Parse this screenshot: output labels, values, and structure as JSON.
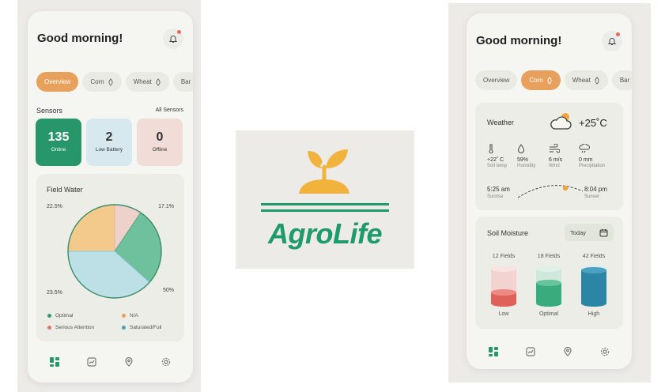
{
  "left_phone": {
    "greeting": "Good morning!",
    "tabs": [
      {
        "label": "Overview",
        "active": true
      },
      {
        "label": "Corn",
        "active": false
      },
      {
        "label": "Wheat",
        "active": false
      },
      {
        "label": "Bar",
        "active": false
      }
    ],
    "sensors": {
      "title": "Sensors",
      "link": "All Sensors",
      "boxes": [
        {
          "value": "135",
          "label": "Online"
        },
        {
          "value": "2",
          "label": "Low Battery"
        },
        {
          "value": "0",
          "label": "Offline"
        }
      ]
    },
    "field_water": {
      "title": "Field Water",
      "pct_top_left": "22.5%",
      "pct_top_right": "17.1%",
      "pct_bottom_left": "23.5%",
      "pct_right": "50%",
      "legend": [
        {
          "label": "Optimal",
          "color": "#3a9a6e"
        },
        {
          "label": "N/A",
          "color": "#e8a15c"
        },
        {
          "label": "Serious Attention",
          "color": "#d9796c"
        },
        {
          "label": "Saturated/Full",
          "color": "#4ba1b3"
        }
      ]
    }
  },
  "logo": {
    "brand": "AgroLife",
    "sprout_color": "#f2b33d",
    "brand_color": "#1e9a6b"
  },
  "right_phone": {
    "greeting": "Good morning!",
    "tabs": [
      {
        "label": "Overview",
        "active": false
      },
      {
        "label": "Corn",
        "active": true
      },
      {
        "label": "Wheat",
        "active": false
      },
      {
        "label": "Bar",
        "active": false
      }
    ],
    "weather": {
      "title": "Weather",
      "temp": "+25˚C",
      "stats": [
        {
          "value": "+22˚ C",
          "label": "Soil temp",
          "icon": "thermometer-icon"
        },
        {
          "value": "59%",
          "label": "Humidity",
          "icon": "droplet-icon"
        },
        {
          "value": "6 m/s",
          "label": "Wind",
          "icon": "wind-icon"
        },
        {
          "value": "0 mm",
          "label": "Precipitation",
          "icon": "rain-cloud-icon"
        }
      ],
      "sunrise_time": "5:25 am",
      "sunrise_label": "Sunrise",
      "sunset_time": "8:04 pm",
      "sunset_label": "Sunset"
    },
    "soil": {
      "title": "Soil Moisture",
      "date_btn": "Today",
      "columns": [
        {
          "count": "12 Fields",
          "label": "Low",
          "color": "#e0605a",
          "fill": 0.3
        },
        {
          "count": "18 Fields",
          "label": "Optimal",
          "color": "#3aab7d",
          "fill": 0.6
        },
        {
          "count": "42 Fields",
          "label": "High",
          "color": "#2b86a6",
          "fill": 0.85
        }
      ]
    }
  }
}
